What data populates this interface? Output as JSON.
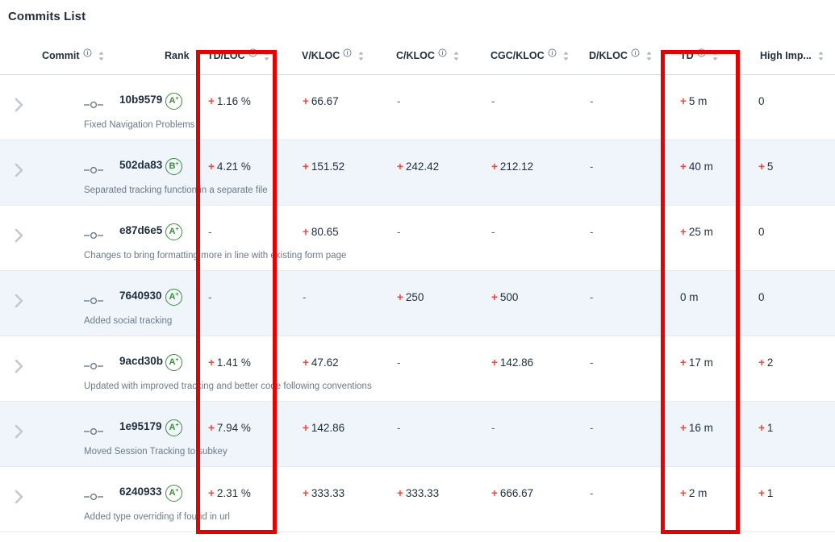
{
  "page": {
    "title": "Commits List"
  },
  "icons": {
    "info": "info-circle-icon",
    "sort": "sort-arrows-icon",
    "expand": "chevron-right-icon",
    "commit_node": "commit-node-icon"
  },
  "colors": {
    "accent_red": "#f4443c",
    "highlight_box": "#e60000",
    "rank_green": "#3a8c3a",
    "alt_row": "#eff5fb",
    "text_dark": "#1f2d3d",
    "text_muted": "#6b7a8a"
  },
  "table": {
    "columns": [
      {
        "key": "expand",
        "label": "",
        "has_info": false,
        "has_sort": false
      },
      {
        "key": "commit",
        "label": "Commit",
        "has_info": true,
        "has_sort": true
      },
      {
        "key": "rank",
        "label": "Rank",
        "has_info": false,
        "has_sort": false
      },
      {
        "key": "td_loc",
        "label": "TD/LOC",
        "has_info": true,
        "has_sort": true
      },
      {
        "key": "v_kloc",
        "label": "V/KLOC",
        "has_info": true,
        "has_sort": true
      },
      {
        "key": "c_kloc",
        "label": "C/KLOC",
        "has_info": true,
        "has_sort": true
      },
      {
        "key": "cgc_kloc",
        "label": "CGC/KLOC",
        "has_info": true,
        "has_sort": true
      },
      {
        "key": "d_kloc",
        "label": "D/KLOC",
        "has_info": true,
        "has_sort": true
      },
      {
        "key": "td",
        "label": "TD",
        "has_info": true,
        "has_sort": true
      },
      {
        "key": "high_imp",
        "label": "High Imp...",
        "has_info": false,
        "has_sort": true
      }
    ],
    "rows": [
      {
        "hash": "10b9579",
        "message": "Fixed Navigation Problems",
        "rank": "A",
        "rank_sup": "+",
        "td_loc": {
          "sign": "+",
          "value": "1.16 %"
        },
        "v_kloc": {
          "sign": "+",
          "value": "66.67"
        },
        "c_kloc": {
          "sign": "",
          "value": "-"
        },
        "cgc_kloc": {
          "sign": "",
          "value": "-"
        },
        "d_kloc": {
          "sign": "",
          "value": "-"
        },
        "td": {
          "sign": "+",
          "value": "5 m"
        },
        "high_imp": {
          "sign": "",
          "value": "0"
        }
      },
      {
        "hash": "502da83",
        "message": "Separated tracking function in a separate file",
        "rank": "B",
        "rank_sup": "+",
        "td_loc": {
          "sign": "+",
          "value": "4.21 %"
        },
        "v_kloc": {
          "sign": "+",
          "value": "151.52"
        },
        "c_kloc": {
          "sign": "+",
          "value": "242.42"
        },
        "cgc_kloc": {
          "sign": "+",
          "value": "212.12"
        },
        "d_kloc": {
          "sign": "",
          "value": "-"
        },
        "td": {
          "sign": "+",
          "value": "40 m"
        },
        "high_imp": {
          "sign": "+",
          "value": "5"
        }
      },
      {
        "hash": "e87d6e5",
        "message": "Changes to bring formatting more in line with existing form page",
        "rank": "A",
        "rank_sup": "+",
        "td_loc": {
          "sign": "",
          "value": "-"
        },
        "v_kloc": {
          "sign": "+",
          "value": "80.65"
        },
        "c_kloc": {
          "sign": "",
          "value": "-"
        },
        "cgc_kloc": {
          "sign": "",
          "value": "-"
        },
        "d_kloc": {
          "sign": "",
          "value": "-"
        },
        "td": {
          "sign": "+",
          "value": "25 m"
        },
        "high_imp": {
          "sign": "",
          "value": "0"
        }
      },
      {
        "hash": "7640930",
        "message": "Added social tracking",
        "rank": "A",
        "rank_sup": "+",
        "td_loc": {
          "sign": "",
          "value": "-"
        },
        "v_kloc": {
          "sign": "",
          "value": "-"
        },
        "c_kloc": {
          "sign": "+",
          "value": "250"
        },
        "cgc_kloc": {
          "sign": "+",
          "value": "500"
        },
        "d_kloc": {
          "sign": "",
          "value": "-"
        },
        "td": {
          "sign": "",
          "value": "0 m"
        },
        "high_imp": {
          "sign": "",
          "value": "0"
        }
      },
      {
        "hash": "9acd30b",
        "message": "Updated with improved tracking and better code following conventions",
        "rank": "A",
        "rank_sup": "+",
        "td_loc": {
          "sign": "+",
          "value": "1.41 %"
        },
        "v_kloc": {
          "sign": "+",
          "value": "47.62"
        },
        "c_kloc": {
          "sign": "",
          "value": "-"
        },
        "cgc_kloc": {
          "sign": "+",
          "value": "142.86"
        },
        "d_kloc": {
          "sign": "",
          "value": "-"
        },
        "td": {
          "sign": "+",
          "value": "17 m"
        },
        "high_imp": {
          "sign": "+",
          "value": "2"
        }
      },
      {
        "hash": "1e95179",
        "message": "Moved Session Tracking to subkey",
        "rank": "A",
        "rank_sup": "+",
        "td_loc": {
          "sign": "+",
          "value": "7.94 %"
        },
        "v_kloc": {
          "sign": "+",
          "value": "142.86"
        },
        "c_kloc": {
          "sign": "",
          "value": "-"
        },
        "cgc_kloc": {
          "sign": "",
          "value": "-"
        },
        "d_kloc": {
          "sign": "",
          "value": "-"
        },
        "td": {
          "sign": "+",
          "value": "16 m"
        },
        "high_imp": {
          "sign": "+",
          "value": "1"
        }
      },
      {
        "hash": "6240933",
        "message": "Added type overriding if found in url",
        "rank": "A",
        "rank_sup": "+",
        "td_loc": {
          "sign": "+",
          "value": "2.31 %"
        },
        "v_kloc": {
          "sign": "+",
          "value": "333.33"
        },
        "c_kloc": {
          "sign": "+",
          "value": "333.33"
        },
        "cgc_kloc": {
          "sign": "+",
          "value": "666.67"
        },
        "d_kloc": {
          "sign": "",
          "value": "-"
        },
        "td": {
          "sign": "+",
          "value": "2 m"
        },
        "high_imp": {
          "sign": "+",
          "value": "1"
        }
      }
    ]
  },
  "annotations": {
    "highlight_boxes": [
      {
        "name": "td-loc-column-highlight",
        "column": "TD/LOC"
      },
      {
        "name": "td-column-highlight",
        "column": "TD"
      }
    ]
  }
}
